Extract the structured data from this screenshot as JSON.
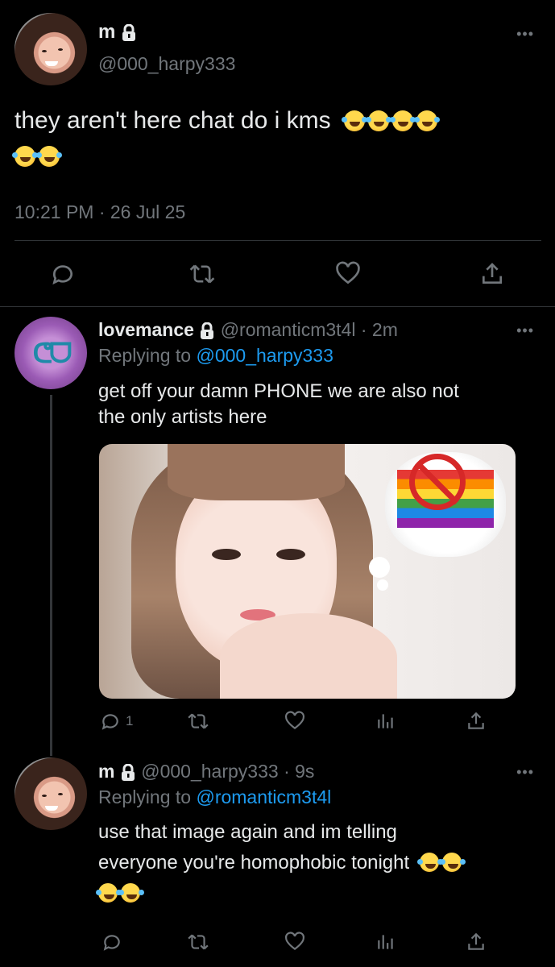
{
  "main_tweet": {
    "display_name": "m",
    "handle": "@000_harpy333",
    "text": "they aren't here chat do i kms",
    "timestamp": "10:21 PM · 26 Jul 25",
    "emoji": "rolling-on-floor-laughing-emoji",
    "emoji_count": 6
  },
  "reply1": {
    "display_name": "lovemance",
    "handle": "@romanticm3t4l",
    "time": "· 2m",
    "replying_prefix": "Replying to",
    "replying_to": "@000_harpy333",
    "text_line1": "get off your damn PHONE we are also not",
    "text_line2": "the only artists here",
    "reply_count": "1"
  },
  "reply2": {
    "display_name": "m",
    "handle": "@000_harpy333",
    "time": "· 9s",
    "replying_prefix": "Replying to",
    "replying_to": "@romanticm3t4l",
    "text_line1": "use that image again and im telling",
    "text_line2": "everyone you're homophobic tonight",
    "emoji": "face-with-tears-of-joy-emoji",
    "emoji_count": 4
  },
  "more_glyph": "•••",
  "colors": {
    "background": "#000000",
    "text": "#e7e9ea",
    "secondary": "#71767b",
    "link": "#1d9bf0",
    "divider": "#2f3336"
  }
}
